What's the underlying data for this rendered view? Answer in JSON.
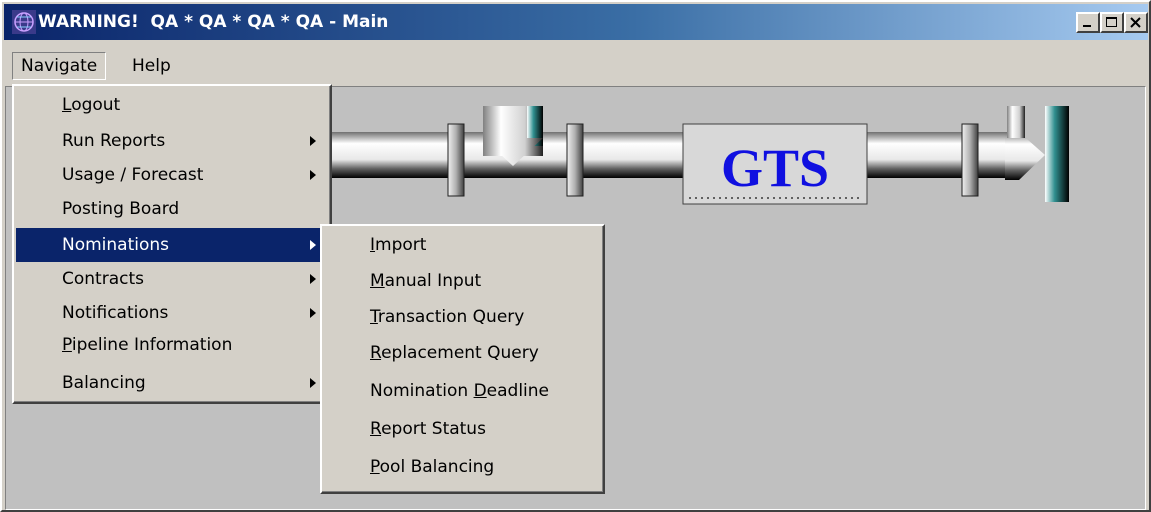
{
  "window": {
    "title": "WARNING!  QA * QA * QA * QA - Main",
    "icon": "globe-app-icon",
    "controls": [
      "minimize-icon",
      "maximize-icon",
      "close-icon"
    ]
  },
  "menubar": {
    "items": [
      {
        "label": "Navigate",
        "active": true
      },
      {
        "label": "Help"
      }
    ]
  },
  "navigate_menu": {
    "items": [
      {
        "label": "Logout",
        "accel": "L",
        "submenu": false
      },
      {
        "label": "Run Reports",
        "submenu": true
      },
      {
        "label": "Usage / Forecast",
        "submenu": true
      },
      {
        "label": "Posting Board",
        "submenu": false
      },
      {
        "label": "Nominations",
        "submenu": true,
        "highlighted": true
      },
      {
        "label": "Contracts",
        "submenu": true
      },
      {
        "label": "Notifications",
        "submenu": true
      },
      {
        "label": "Pipeline Information",
        "accel": "P",
        "submenu": false
      },
      {
        "label": "Balancing",
        "submenu": true
      }
    ]
  },
  "nominations_submenu": {
    "items": [
      {
        "pre": "",
        "acc": "I",
        "post": "mport"
      },
      {
        "pre": "",
        "acc": "M",
        "post": "anual Input"
      },
      {
        "pre": "",
        "acc": "T",
        "post": "ransaction Query"
      },
      {
        "pre": "",
        "acc": "R",
        "post": "eplacement Query"
      },
      {
        "pre": "Nomination ",
        "acc": "D",
        "post": "eadline"
      },
      {
        "pre": "",
        "acc": "R",
        "post": "eport Status"
      },
      {
        "pre": "",
        "acc": "P",
        "post": "ool Balancing"
      }
    ]
  },
  "banner": {
    "logo_text": "GTS",
    "logo_color": "#1010e0"
  },
  "colors": {
    "highlight": "#0a246a",
    "face": "#d4d0c8",
    "client": "#c0c0c0"
  }
}
